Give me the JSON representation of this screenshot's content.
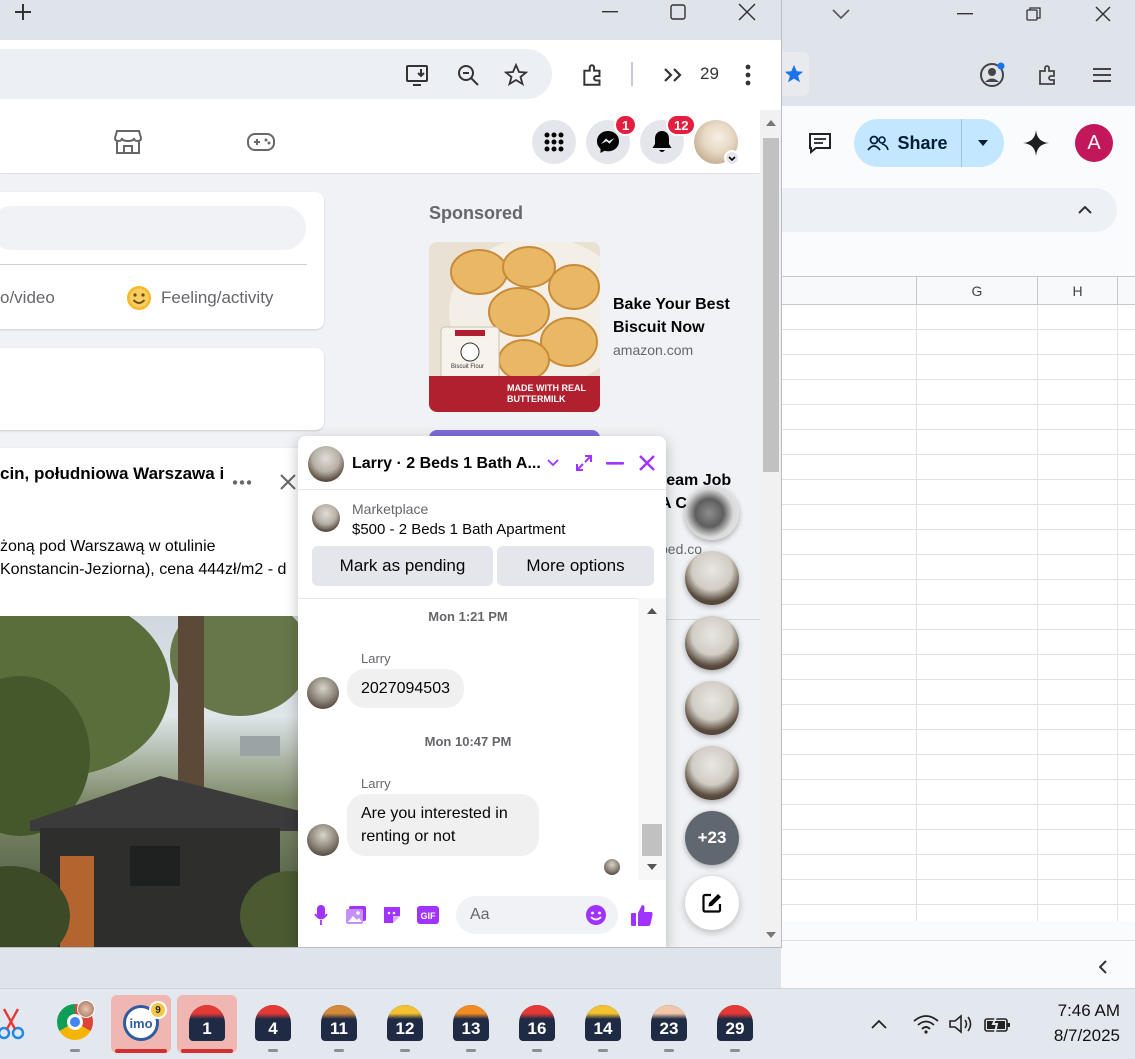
{
  "sheets": {
    "share_label": "Share",
    "avatar_letter": "A",
    "columns": [
      "G",
      "H"
    ]
  },
  "browser": {
    "tab_count": "29"
  },
  "facebook": {
    "badges": {
      "messenger": "1",
      "notifications": "12"
    },
    "composer": {
      "photo_video_label": "o/video",
      "feeling_label": "Feeling/activity"
    },
    "post": {
      "title": "cin, południowa Warszawa i",
      "line1": "żoną pod Warszawą w otulinie",
      "line2": "Konstancin-Jeziorna), cena 444zł/m2 - d"
    },
    "sponsored": {
      "heading": "Sponsored",
      "ad1_title": "Bake Your Best Biscuit Now",
      "ad1_domain": "amazon.com",
      "ad1_banner": "MADE WITH REAL BUTTERMILK",
      "ad1_product": "Biscuit Flour",
      "ad2_title_fragment": "ream Job",
      "ad2_title_fragment2": "A C",
      "ad2_domain_fragment": "ped.co"
    }
  },
  "chat": {
    "title": "Larry · 2 Beds 1 Bath A...",
    "marketplace_label": "Marketplace",
    "listing": "$500 - 2 Beds 1 Bath Apartment",
    "mark_pending": "Mark as pending",
    "more_options": "More options",
    "messages": [
      {
        "timestamp": "Mon 1:21 PM",
        "sender": "Larry",
        "text": "2027094503"
      },
      {
        "timestamp": "Mon 10:47 PM",
        "sender": "Larry",
        "text": "Are you interested in renting or not"
      }
    ],
    "input_placeholder": "Aa",
    "more_chats": "+23"
  },
  "taskbar": {
    "imo_badge": "9",
    "imo_label": "imo",
    "dock_items": [
      "1",
      "4",
      "11",
      "12",
      "13",
      "16",
      "14",
      "23",
      "29"
    ],
    "time": "7:46 AM",
    "date": "8/7/2025"
  }
}
